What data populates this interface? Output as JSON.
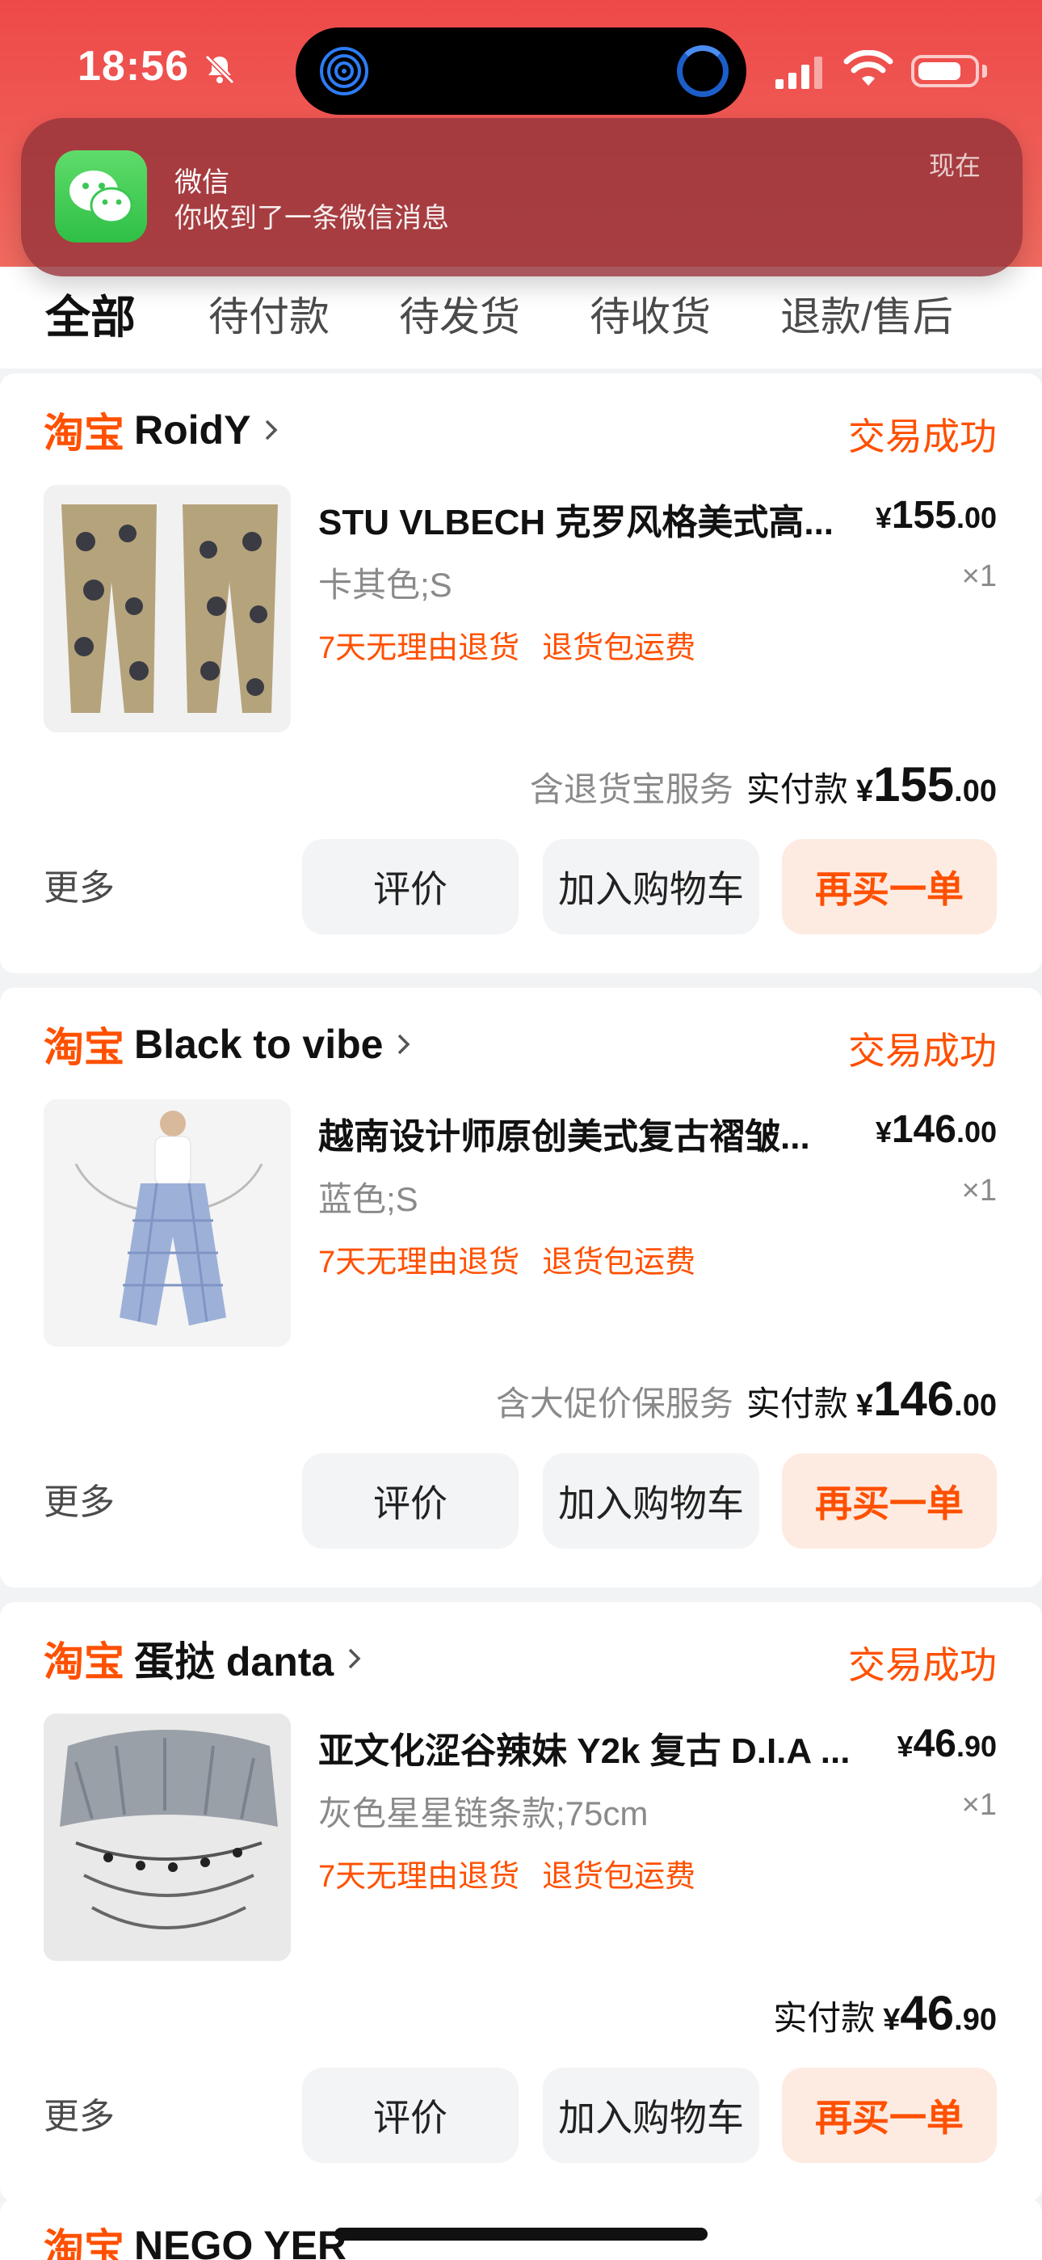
{
  "status_bar": {
    "time": "18:56"
  },
  "notification": {
    "app": "微信",
    "message": "你收到了一条微信消息",
    "time": "现在",
    "icon": "wechat-icon"
  },
  "tabs": [
    {
      "label": "全部",
      "active": true
    },
    {
      "label": "待付款",
      "active": false
    },
    {
      "label": "待发货",
      "active": false
    },
    {
      "label": "待收货",
      "active": false
    },
    {
      "label": "退款/售后",
      "active": false
    }
  ],
  "orders": [
    {
      "brand": "淘宝",
      "shop": "RoidY",
      "status": "交易成功",
      "title": "STU VLBECH 克罗风格美式高...",
      "price_symbol": "¥",
      "price_int": "155",
      "price_dec": ".00",
      "spec": "卡其色;S",
      "qty": "×1",
      "tags": [
        "7天无理由退货",
        "退货包运费"
      ],
      "service": "含退货宝服务",
      "paid_label": "实付款",
      "paid_symbol": "¥",
      "paid_int": "155",
      "paid_dec": ".00",
      "more": "更多",
      "btn_review": "评价",
      "btn_cart": "加入购物车",
      "btn_rebuy": "再买一单"
    },
    {
      "brand": "淘宝",
      "shop": "Black to vibe",
      "status": "交易成功",
      "title": "越南设计师原创美式复古褶皱...",
      "price_symbol": "¥",
      "price_int": "146",
      "price_dec": ".00",
      "spec": "蓝色;S",
      "qty": "×1",
      "tags": [
        "7天无理由退货",
        "退货包运费"
      ],
      "service": "含大促价保服务",
      "paid_label": "实付款",
      "paid_symbol": "¥",
      "paid_int": "146",
      "paid_dec": ".00",
      "more": "更多",
      "btn_review": "评价",
      "btn_cart": "加入购物车",
      "btn_rebuy": "再买一单"
    },
    {
      "brand": "淘宝",
      "shop": "蛋挞 danta",
      "status": "交易成功",
      "title": "亚文化涩谷辣妹 Y2k 复古 D.I.A ...",
      "price_symbol": "¥",
      "price_int": "46",
      "price_dec": ".90",
      "spec": "灰色星星链条款;75cm",
      "qty": "×1",
      "tags": [
        "7天无理由退货",
        "退货包运费"
      ],
      "service": "",
      "paid_label": "实付款",
      "paid_symbol": "¥",
      "paid_int": "46",
      "paid_dec": ".90",
      "more": "更多",
      "btn_review": "评价",
      "btn_cart": "加入购物车",
      "btn_rebuy": "再买一单"
    }
  ],
  "partial_order": {
    "brand": "淘宝",
    "shop": "NEGO YER"
  },
  "colors": {
    "accent": "#ff5000",
    "header": "#ee4949",
    "rebuy_bg": "#fdebe2",
    "button_bg": "#f3f4f6"
  }
}
